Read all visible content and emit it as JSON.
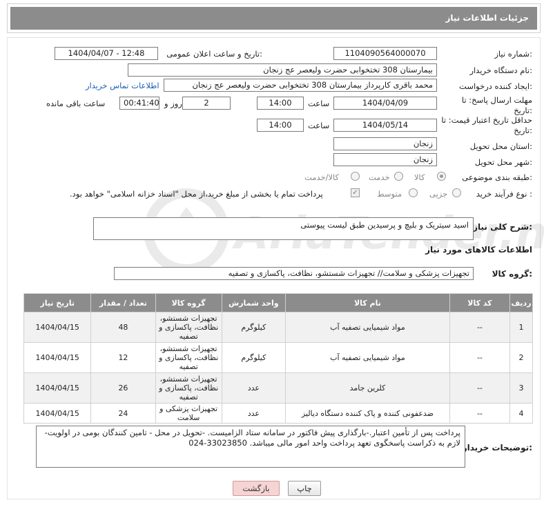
{
  "header": {
    "title": "جزئیات اطلاعات نیاز"
  },
  "fields": {
    "need_number_label": "شماره نیاز:",
    "need_number": "1104090564000070",
    "announce_label": "تاریخ و ساعت اعلان عمومی:",
    "announce_value": "1404/04/07 - 12:48",
    "buyer_org_label": "نام دستگاه خریدار:",
    "buyer_org": "بیمارستان 308 تختخوابی حضرت ولیعصر عج  زنجان",
    "requester_label": "ایجاد کننده درخواست:",
    "requester": "محمد باقری کارپرداز بیمارستان 308 تختخوابی حضرت ولیعصر عج  زنجان",
    "buyer_contact_link": "اطلاعات تماس خریدار",
    "reply_deadline_label": "مهلت ارسال پاسخ: تا تاریخ:",
    "reply_date": "1404/04/09",
    "time_label": "ساعت",
    "reply_time": "14:00",
    "days_value": "2",
    "days_label": "روز و",
    "remaining_time": "00:41:40",
    "remaining_label": "ساعت باقی مانده",
    "price_deadline_label": "حداقل تاریخ اعتبار قیمت: تا تاریخ:",
    "price_date": "1404/05/14",
    "price_time": "14:00",
    "province_label": "استان محل تحویل:",
    "province": "زنجان",
    "city_label": "شهر محل تحویل:",
    "city": "زنجان",
    "category_label": "طبقه بندی موضوعی:",
    "category_options": [
      "کالا",
      "خدمت",
      "کالا/خدمت"
    ],
    "process_label": "نوع فرآیند خرید :",
    "process_options": [
      "جزیی",
      "متوسط"
    ],
    "payment_note": "پرداخت تمام یا بخشی از مبلغ خرید،از محل \"اسناد خزانه اسلامی\" خواهد بود."
  },
  "summary": {
    "label": "شرح کلی نیاز:",
    "value": "اسید سیتریک و بلیچ و پرسیدین طبق لیست پیوستی"
  },
  "goods_section": {
    "title": "اطلاعات کالاهای مورد نیاز",
    "group_label": "گروه کالا:",
    "group_value": "تجهیزات پزشکی و سلامت// تجهیزات شستشو، نظافت، پاکسازی و تصفیه"
  },
  "table": {
    "headers": [
      "ردیف",
      "کد کالا",
      "نام کالا",
      "واحد شمارش",
      "گروه کالا",
      "تعداد / مقدار",
      "تاریخ نیاز"
    ],
    "rows": [
      [
        "1",
        "--",
        "مواد شیمیایی تصفیه آب",
        "کیلوگرم",
        "تجهیزات شستشو، نظافت، پاکسازی و تصفیه",
        "48",
        "1404/04/15"
      ],
      [
        "2",
        "--",
        "مواد شیمیایی تصفیه آب",
        "کیلوگرم",
        "تجهیزات شستشو، نظافت، پاکسازی و تصفیه",
        "12",
        "1404/04/15"
      ],
      [
        "3",
        "--",
        "کلرین جامد",
        "عدد",
        "تجهیزات شستشو، نظافت، پاکسازی و تصفیه",
        "26",
        "1404/04/15"
      ],
      [
        "4",
        "--",
        "ضدعفونی کننده و پاک کننده دستگاه دیالیز",
        "عدد",
        "تجهیزات پزشکی و سلامت",
        "24",
        "1404/04/15"
      ]
    ]
  },
  "buyer_notes": {
    "label": "توضیحات خریدار:",
    "lines": [
      "پرداخت پس از تأمین اعتبار.-بارگذاری پیش فاکتور در سامانه ستاد الزامیست. -تحویل در محل - تامین کنندگان بومی در اولویت-",
      "لازم به ذکراست پاسخگوی تعهد پرداخت واحد امور مالی میباشد. 33023850-024"
    ]
  },
  "buttons": {
    "print": "چاپ",
    "back": "بازگشت"
  },
  "watermark": {
    "text": "AriaTender.net"
  }
}
